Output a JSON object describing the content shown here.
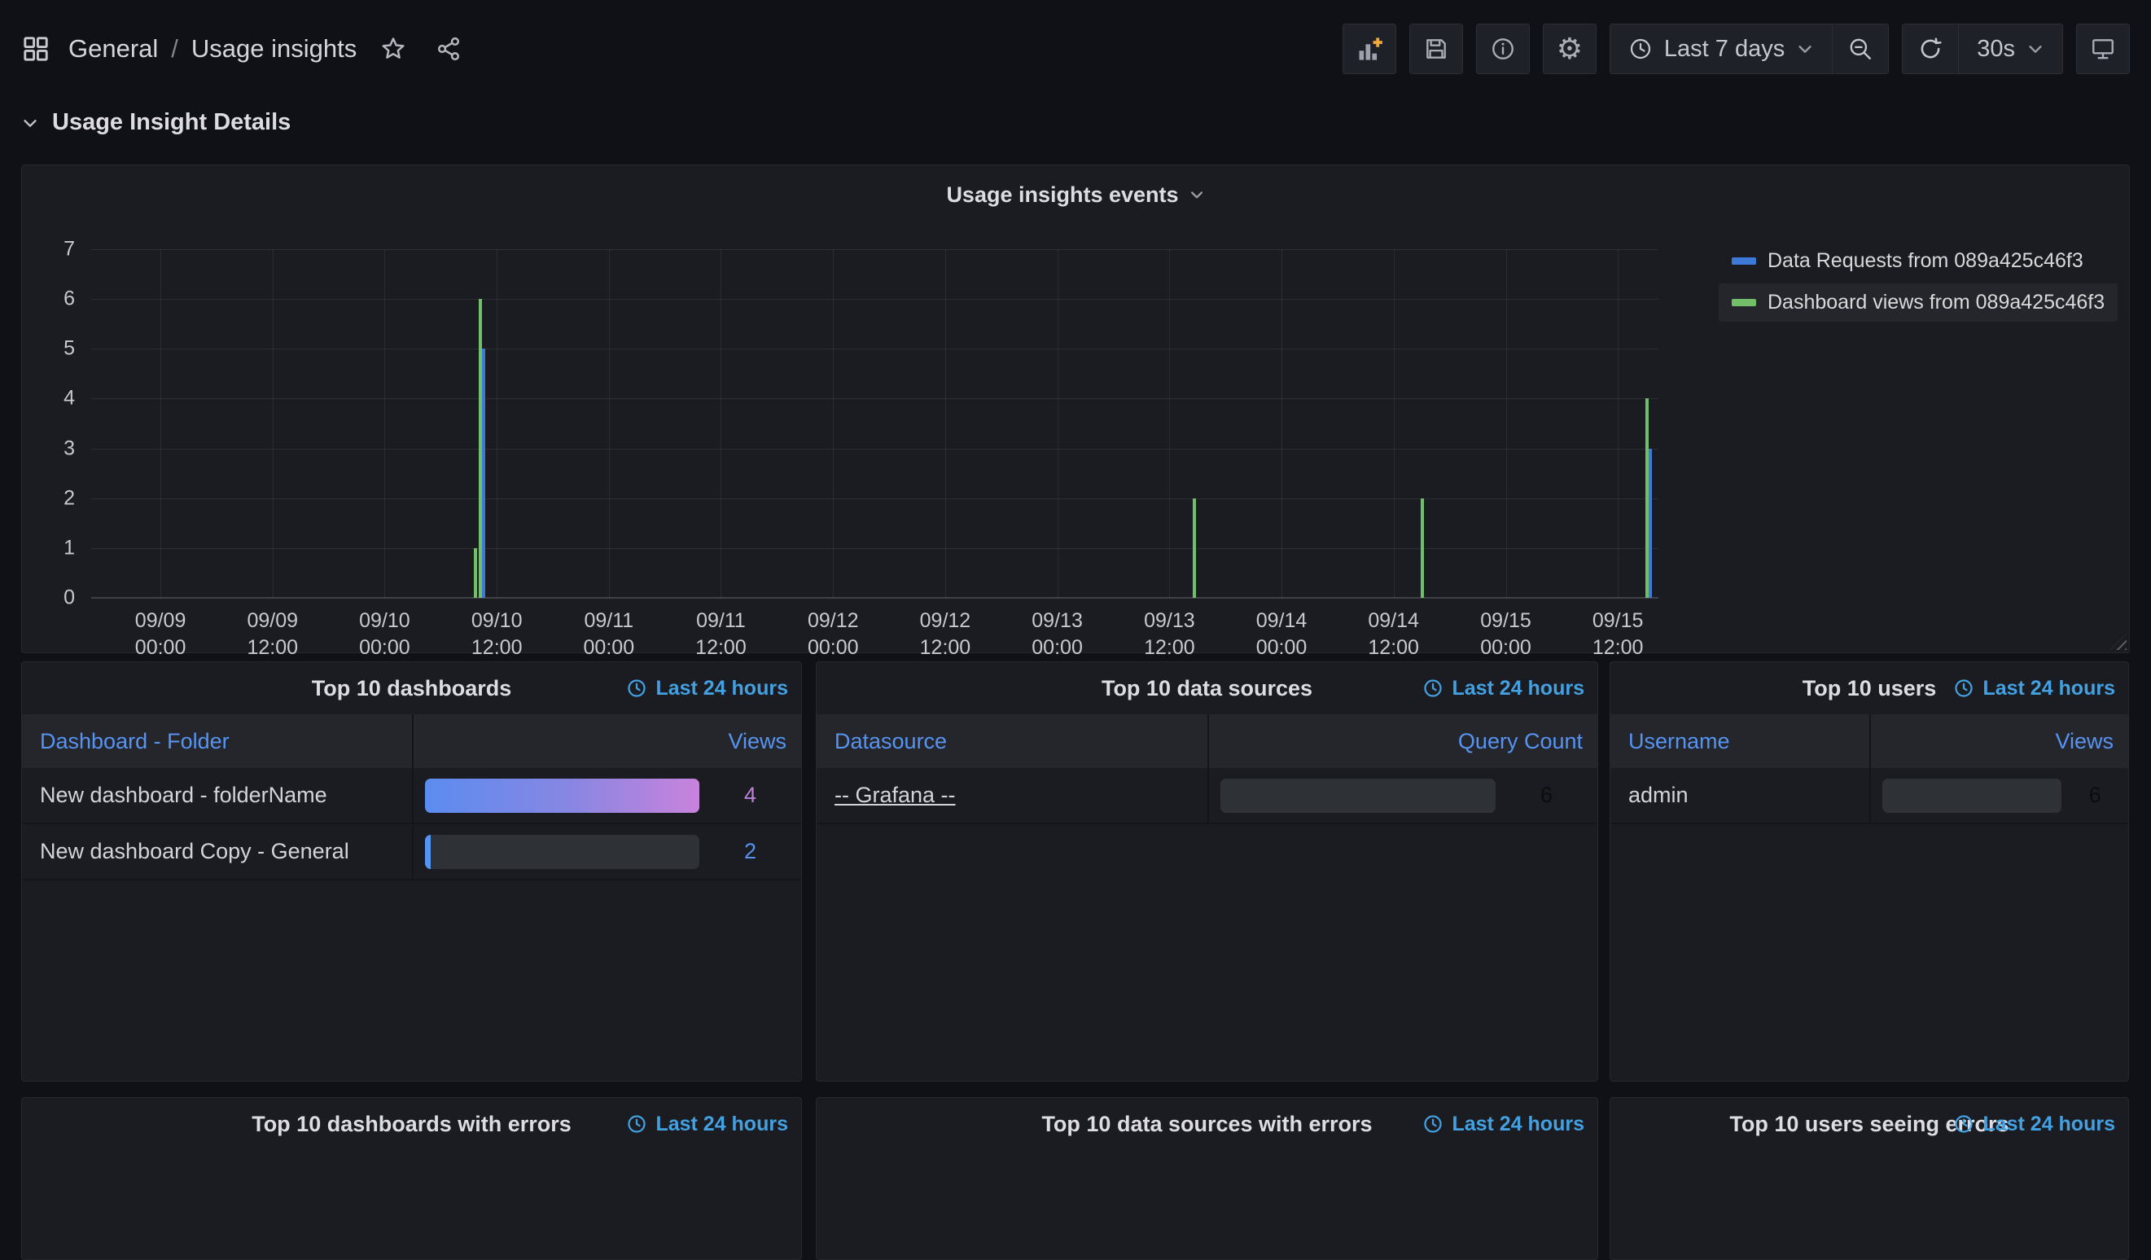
{
  "nav": {
    "breadcrumb": {
      "folder": "General",
      "separator": "/",
      "page": "Usage insights"
    },
    "toolbar": {
      "time_range_label": "Last 7 days",
      "refresh_interval": "30s"
    }
  },
  "icons": {
    "gear_glyph": "⚙"
  },
  "row": {
    "title": "Usage Insight Details"
  },
  "chart_data": {
    "type": "bar",
    "title": "Usage insights events",
    "ylabel": "",
    "xlabel": "",
    "ylim": [
      0,
      7
    ],
    "yticks": [
      0,
      1,
      2,
      3,
      4,
      5,
      6,
      7
    ],
    "grid": true,
    "legend_position": "right-top",
    "xticks": [
      {
        "date": "09/09",
        "time": "00:00"
      },
      {
        "date": "09/09",
        "time": "12:00"
      },
      {
        "date": "09/10",
        "time": "00:00"
      },
      {
        "date": "09/10",
        "time": "12:00"
      },
      {
        "date": "09/11",
        "time": "00:00"
      },
      {
        "date": "09/11",
        "time": "12:00"
      },
      {
        "date": "09/12",
        "time": "00:00"
      },
      {
        "date": "09/12",
        "time": "12:00"
      },
      {
        "date": "09/13",
        "time": "00:00"
      },
      {
        "date": "09/13",
        "time": "12:00"
      },
      {
        "date": "09/14",
        "time": "00:00"
      },
      {
        "date": "09/14",
        "time": "12:00"
      },
      {
        "date": "09/15",
        "time": "00:00"
      },
      {
        "date": "09/15",
        "time": "12:00"
      }
    ],
    "tick_fracs": [
      0.0442,
      0.1157,
      0.1872,
      0.2588,
      0.3303,
      0.4018,
      0.4734,
      0.5449,
      0.6164,
      0.688,
      0.7595,
      0.831,
      0.9026,
      0.9741
    ],
    "series": [
      {
        "name": "Data Requests from 089a425c46f3",
        "color": "#3d7ad8",
        "highlight": false
      },
      {
        "name": "Dashboard views from 089a425c46f3",
        "color": "#73bf69",
        "highlight": true
      }
    ],
    "bars": [
      {
        "x": 0.2452,
        "value": 1,
        "series": 1,
        "approx_time": "09/10 ~11:30"
      },
      {
        "x": 0.2483,
        "value": 6,
        "series": 1,
        "approx_time": "09/10 ~11:45"
      },
      {
        "x": 0.2504,
        "value": 5,
        "series": 0,
        "approx_time": "09/10 ~11:45"
      },
      {
        "x": 0.7039,
        "value": 2,
        "series": 1,
        "approx_time": "09/13 ~13:30"
      },
      {
        "x": 0.8494,
        "value": 2,
        "series": 1,
        "approx_time": "09/14 ~13:45"
      },
      {
        "x": 0.9928,
        "value": 4,
        "series": 1,
        "approx_time": "09/15 ~12:30"
      },
      {
        "x": 0.9948,
        "value": 3,
        "series": 0,
        "approx_time": "09/15 ~12:30"
      }
    ]
  },
  "panels": {
    "dashboards": {
      "title": "Top 10 dashboards",
      "time": "Last 24 hours",
      "columns": [
        "Dashboard - Folder",
        "Views"
      ],
      "rows": [
        {
          "label": "New dashboard - folderName",
          "link": false,
          "value": "4",
          "gauge": "full",
          "value_color": "#bd7fd9"
        },
        {
          "label": "New dashboard Copy - General",
          "link": false,
          "value": "2",
          "gauge": "sliver",
          "value_color": "#5794f2"
        }
      ]
    },
    "datasources": {
      "title": "Top 10 data sources",
      "time": "Last 24 hours",
      "columns": [
        "Datasource",
        "Query Count"
      ],
      "rows": [
        {
          "label": "-- Grafana --",
          "link": true,
          "value": "6",
          "gauge": "empty",
          "value_color": "#0b0c0e"
        }
      ]
    },
    "users": {
      "title": "Top 10 users",
      "time": "Last 24 hours",
      "columns": [
        "Username",
        "Views"
      ],
      "rows": [
        {
          "label": "admin",
          "link": false,
          "value": "6",
          "gauge": "empty",
          "value_color": "#0b0c0e"
        }
      ]
    },
    "dashboards_errors": {
      "title": "Top 10 dashboards with errors",
      "time": "Last 24 hours"
    },
    "datasources_errors": {
      "title": "Top 10 data sources with errors",
      "time": "Last 24 hours"
    },
    "users_errors": {
      "title": "Top 10 users seeing errors",
      "time": "Last 24 hours"
    }
  },
  "colors": {
    "page_bg": "#101116",
    "panel_bg": "#1a1c21",
    "table_header_bg": "#24262b",
    "link_blue": "#5794f2",
    "time_badge_blue": "#43a1e2",
    "bar_blue": "#3d7ad8",
    "bar_green": "#73bf69",
    "gauge_gradient_start": "#5b8cf0",
    "gauge_gradient_end": "#c983dc",
    "add_panel_plus_orange": "#f1a73b"
  }
}
